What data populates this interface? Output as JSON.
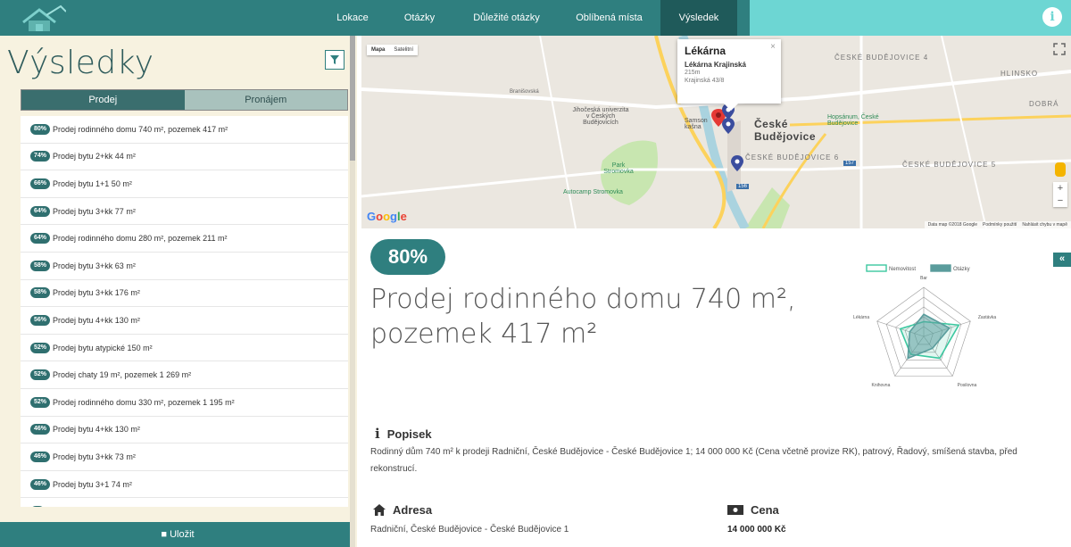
{
  "nav": {
    "steps": [
      "Lokace",
      "Otázky",
      "Důležité otázky",
      "Oblíbená místa",
      "Výsledek"
    ],
    "active_step": "Výsledek",
    "info_label": "i",
    "colors": {
      "dark_teal": "#2f7f7f",
      "light_teal": "#6dd6d3"
    }
  },
  "left": {
    "title": "Výsledky",
    "tabs": [
      "Prodej",
      "Pronájem"
    ],
    "active_tab": "Prodej",
    "results": [
      {
        "pct": "80%",
        "label": "Prodej rodinného domu 740 m², pozemek 417 m²"
      },
      {
        "pct": "74%",
        "label": "Prodej bytu 2+kk 44 m²"
      },
      {
        "pct": "66%",
        "label": "Prodej bytu 1+1 50 m²"
      },
      {
        "pct": "64%",
        "label": "Prodej bytu 3+kk 77 m²"
      },
      {
        "pct": "64%",
        "label": "Prodej rodinného domu 280 m², pozemek 211 m²"
      },
      {
        "pct": "58%",
        "label": "Prodej bytu 3+kk 63 m²"
      },
      {
        "pct": "58%",
        "label": "Prodej bytu 3+kk 176 m²"
      },
      {
        "pct": "56%",
        "label": "Prodej bytu 4+kk 130 m²"
      },
      {
        "pct": "52%",
        "label": "Prodej bytu atypické 150 m²"
      },
      {
        "pct": "52%",
        "label": "Prodej chaty 19 m², pozemek 1 269 m²"
      },
      {
        "pct": "52%",
        "label": "Prodej rodinného domu 330 m², pozemek 1 195 m²"
      },
      {
        "pct": "46%",
        "label": "Prodej bytu 4+kk 130 m²"
      },
      {
        "pct": "46%",
        "label": "Prodej bytu 3+kk 73 m²"
      },
      {
        "pct": "46%",
        "label": "Prodej bytu 3+1 74 m²"
      }
    ],
    "save_label": "Uložit"
  },
  "map": {
    "types": [
      "Mapa",
      "Satelitní"
    ],
    "active_type": "Mapa",
    "popup": {
      "title": "Lékárna",
      "name": "Lékárna Krajinská",
      "distance": "215m",
      "address": "Krajinská 43/8",
      "close": "×"
    },
    "labels": {
      "city": "České Budějovice",
      "district4": "ČESKÉ BUDĚJOVICE 4",
      "district6": "ČESKÉ BUDĚJOVICE 6",
      "district5": "ČESKÉ BUDĚJOVICE 5",
      "hlinsko": "HLINSKO",
      "dobra": "DOBRÁ",
      "university": "Jihočeská univerzita v Českých Budějovicích",
      "park": "Park Stromovka",
      "autocamp": "Autocamp Stromovka",
      "hopsanum": "Hopsánum, České Budějovice",
      "samson": "Samson kašna",
      "road_157": "157",
      "road_156": "156",
      "branisovska": "Branišovská"
    },
    "google": [
      "G",
      "o",
      "o",
      "g",
      "l",
      "e"
    ],
    "footer": [
      "Data map ©2018 Google",
      "Podmínky použití",
      "Nahlásit chybu v mapě"
    ],
    "zoom_in": "+",
    "zoom_out": "−",
    "collapse": "«"
  },
  "detail": {
    "percent": "80%",
    "title_line1": "Prodej rodinného domu 740 m²,",
    "title_line2": "pozemek 417 m²",
    "chart_data": {
      "type": "radar",
      "axes": [
        "Bar",
        "Zastávka",
        "Posilovna",
        "Knihovna",
        "Lékárna"
      ],
      "series": [
        {
          "name": "Nemovitost",
          "values": [
            0.3,
            0.75,
            0.55,
            0.45,
            0.5
          ],
          "color": "#3cc8a0"
        },
        {
          "name": "Otázky",
          "values": [
            0.45,
            0.55,
            0.3,
            0.55,
            0.3
          ],
          "color": "#5a9c9c"
        }
      ],
      "legend": "top"
    },
    "popisek": {
      "heading": "Popisek",
      "text": "Rodinný dům 740 m² k prodeji Radniční, České Budějovice - České Budějovice 1; 14 000 000 Kč (Cena včetně provize RK), patrový, Řadový, smíšená stavba, před rekonstrucí."
    },
    "adresa": {
      "heading": "Adresa",
      "value": "Radniční, České Budějovice - České Budějovice 1"
    },
    "cena": {
      "heading": "Cena",
      "value": "14 000 000 Kč"
    }
  }
}
